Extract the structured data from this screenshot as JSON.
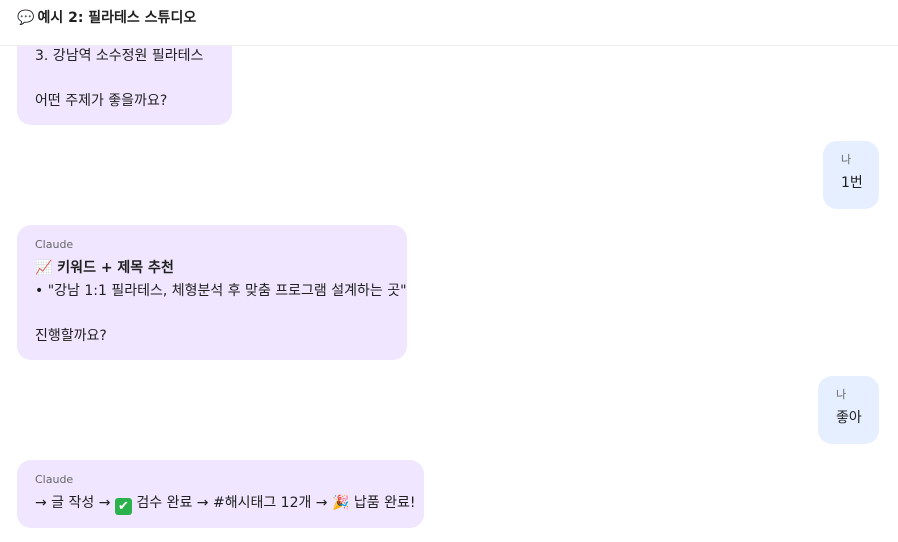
{
  "header": {
    "icon": "speech-bubble-icon",
    "icon_glyph": "💬",
    "title": "예시 2: 필라테스 스튜디오"
  },
  "messages": [
    {
      "role": "assistant",
      "sender": "",
      "lines": [
        "3. 강남역 소수정원 필라테스",
        "",
        "어떤 주제가 좋을까요?"
      ]
    },
    {
      "role": "user",
      "sender": "나",
      "lines": [
        "1번"
      ]
    },
    {
      "role": "assistant",
      "sender": "Claude",
      "lines": [
        "📈 키워드 + 제목 추천",
        "• \"강남 1:1 필라테스, 체형분석 후 맞춤 프로그램 설계하는 곳\"",
        "",
        "진행할까요?"
      ]
    },
    {
      "role": "user",
      "sender": "나",
      "lines": [
        "좋아"
      ]
    },
    {
      "role": "assistant",
      "sender": "Claude",
      "final_line": {
        "part1": "→ 글 작성 → ",
        "check_icon": "check-mark-button-icon",
        "check_glyph": "✔",
        "part2": " 검수 완료 → #해시태그 12개 → ",
        "party_icon": "party-popper-icon",
        "party_glyph": "🎉",
        "part3": " 납품 완료!"
      }
    }
  ],
  "colors": {
    "assistant_bubble": "#f1e6ff",
    "user_bubble": "#e5efff",
    "check_green": "#2bb24c"
  }
}
